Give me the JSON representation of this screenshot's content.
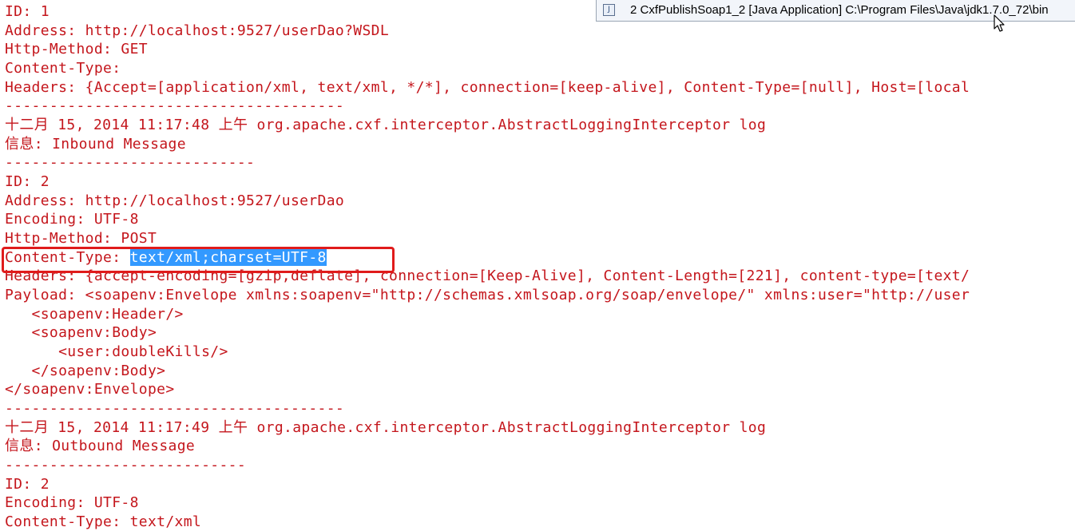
{
  "launch": {
    "label": "2 CxfPublishSoap1_2 [Java Application] C:\\Program Files\\Java\\jdk1.7.0_72\\bin"
  },
  "colors": {
    "log_text": "#c4161c",
    "selection": "#3399ff",
    "highlight_box": "#e01b1b"
  },
  "console": {
    "lines": [
      "ID: 1",
      "Address: http://localhost:9527/userDao?WSDL",
      "Http-Method: GET",
      "Content-Type:",
      "Headers: {Accept=[application/xml, text/xml, */*], connection=[keep-alive], Content-Type=[null], Host=[local",
      "--------------------------------------",
      "十二月 15, 2014 11:17:48 上午 org.apache.cxf.interceptor.AbstractLoggingInterceptor log",
      "信息: Inbound Message",
      "----------------------------",
      "ID: 2",
      "Address: http://localhost:9527/userDao",
      "Encoding: UTF-8",
      "Http-Method: POST",
      "Content-Type: ",
      "Headers: {accept-encoding=[gzip,deflate], connection=[Keep-Alive], Content-Length=[221], content-type=[text/",
      "Payload: <soapenv:Envelope xmlns:soapenv=\"http://schemas.xmlsoap.org/soap/envelope/\" xmlns:user=\"http://user",
      "   <soapenv:Header/>",
      "   <soapenv:Body>",
      "      <user:doubleKills/>",
      "   </soapenv:Body>",
      "</soapenv:Envelope>",
      "--------------------------------------",
      "十二月 15, 2014 11:17:49 上午 org.apache.cxf.interceptor.AbstractLoggingInterceptor log",
      "信息: Outbound Message",
      "---------------------------",
      "ID: 2",
      "Encoding: UTF-8",
      "Content-Type: text/xml"
    ],
    "selected_text": "text/xml;charset=UTF-8"
  }
}
